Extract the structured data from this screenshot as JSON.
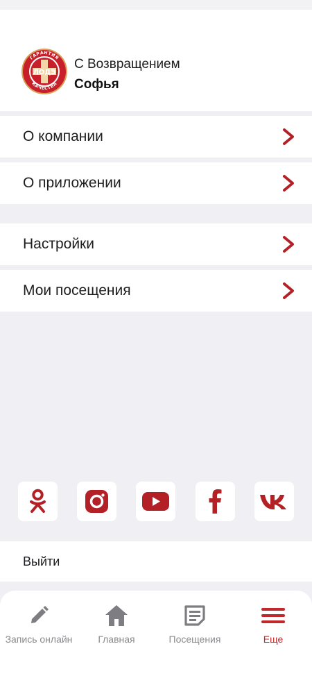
{
  "profile": {
    "greeting": "С Возвращением",
    "name": "Софья",
    "logo": {
      "icon": "lodz-logo-icon",
      "ring_top_text": "ГАРАНТИЯ",
      "ring_bottom_text": "КАЧЕСТВА",
      "center_text": "ЛОДЭ"
    }
  },
  "menu": {
    "items": [
      {
        "label": "О компании",
        "icon": "chevron-right-icon"
      },
      {
        "label": "О приложении",
        "icon": "chevron-right-icon"
      },
      {
        "label": "Настройки",
        "icon": "chevron-right-icon"
      },
      {
        "label": "Мои посещения",
        "icon": "chevron-right-icon"
      }
    ]
  },
  "socials": [
    {
      "icon": "odnoklassniki-icon"
    },
    {
      "icon": "instagram-icon"
    },
    {
      "icon": "youtube-icon"
    },
    {
      "icon": "facebook-icon"
    },
    {
      "icon": "vk-icon"
    }
  ],
  "logout": {
    "label": "Выйти"
  },
  "tabbar": {
    "tabs": [
      {
        "label": "Запись онлайн",
        "icon": "pencil-icon",
        "active": false
      },
      {
        "label": "Главная",
        "icon": "home-icon",
        "active": false
      },
      {
        "label": "Посещения",
        "icon": "notes-icon",
        "active": false
      },
      {
        "label": "Еще",
        "icon": "menu-icon",
        "active": true
      }
    ]
  },
  "colors": {
    "accent": "#c0282b",
    "inactive_tab": "#8a8a8e",
    "background": "#f0eff4"
  }
}
